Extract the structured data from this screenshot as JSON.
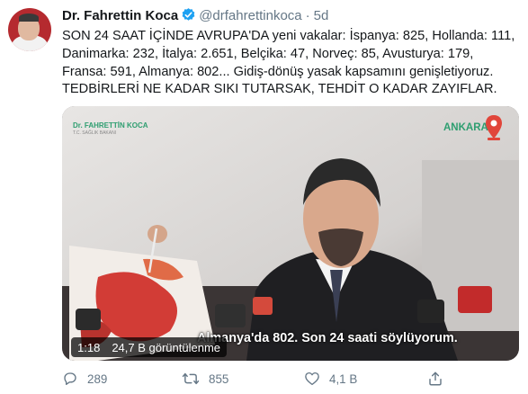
{
  "tweet": {
    "author_name": "Dr. Fahrettin Koca",
    "handle": "@drfahrettinkoca",
    "separator": "·",
    "time": "5d",
    "text": "SON 24 SAAT İÇİNDE AVRUPA'DA yeni vakalar: İspanya: 825, Hollanda: 111, Danimarka: 232, İtalya: 2.651, Belçika: 47, Norveç: 85, Avusturya: 179, Fransa: 591, Almanya: 802... Gidiş-dönüş yasak kapsamını genişletiyoruz. TEDBİRLERİ NE KADAR SIKI TUTARSAK, TEHDİT O KADAR ZAYIFLAR."
  },
  "media": {
    "overlay_logo_title": "Dr. FAHRETTİN KOCA",
    "overlay_logo_sub": "T.C. SAĞLIK BAKANI",
    "location_label": "ANKARA",
    "caption": "Almanya'da 802. Son 24 saati söylüyorum.",
    "duration": "1:18",
    "views": "24,7 B görüntülenme"
  },
  "actions": {
    "replies": "289",
    "retweets": "855",
    "likes": "4,1 B"
  },
  "colors": {
    "verified": "#1da1f2",
    "muted": "#657786",
    "overlay_green": "#2e9e70"
  }
}
